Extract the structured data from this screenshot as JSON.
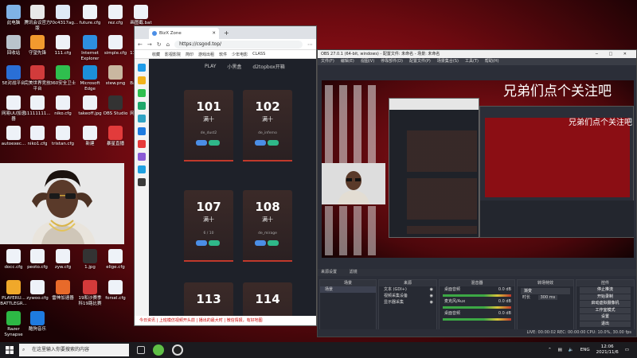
{
  "desktop_icons": [
    {
      "label": "此电脑",
      "color": "#7fb3e6"
    },
    {
      "label": "腾讯会议官方版",
      "color": "#e8e8e8"
    },
    {
      "label": "70c4317ag...",
      "color": "#dfe9f6"
    },
    {
      "label": "future.cfg",
      "color": "#eef2f8"
    },
    {
      "label": "rez.cfg",
      "color": "#eef2f8"
    },
    {
      "label": "画图截.bat",
      "color": "#eef2f8"
    },
    {
      "label": "回收站",
      "color": "#b9c4cc"
    },
    {
      "label": "守望先锋",
      "color": "#f29a2e"
    },
    {
      "label": "111.cfg",
      "color": "#eef2f8"
    },
    {
      "label": "Internet Explorer",
      "color": "#2d8fe0"
    },
    {
      "label": "simple.cfg",
      "color": "#eef2f8"
    },
    {
      "label": "1111...cfg",
      "color": "#eef2f8"
    },
    {
      "label": "5E对战平台",
      "color": "#2a6fd6"
    },
    {
      "label": "完美世界竞技平台",
      "color": "#d23b3b"
    },
    {
      "label": "360安全卫士",
      "color": "#2fbf4e"
    },
    {
      "label": "Microsoft Edge",
      "color": "#1c8fd8"
    },
    {
      "label": "stew.png",
      "color": "#c9b7a0"
    },
    {
      "label": "Bandicam",
      "color": "#d83a3a"
    },
    {
      "label": "网易UU加速器",
      "color": "#eef2f8"
    },
    {
      "label": "11111111...",
      "color": "#eef2f8"
    },
    {
      "label": "niko.cfg",
      "color": "#eef2f8"
    },
    {
      "label": "takeoff.jpg",
      "color": "#eef2f8"
    },
    {
      "label": "OBS Studio",
      "color": "#333333"
    },
    {
      "label": "网易云音乐",
      "color": "#d0343b"
    },
    {
      "label": "autoexec...",
      "color": "#eef2f8"
    },
    {
      "label": "niko1.cfg",
      "color": "#eef2f8"
    },
    {
      "label": "tristan.cfg",
      "color": "#eef2f8"
    },
    {
      "label": "新建",
      "color": "#eef2f8"
    },
    {
      "label": "暴星直播",
      "color": "#e23b3b"
    },
    {
      "label": "腾讯云",
      "color": "#eef2f8"
    },
    {
      "label": "docc.cfg",
      "color": "#eef2f8"
    },
    {
      "label": "peoto.cfg",
      "color": "#eef2f8"
    },
    {
      "label": "zyw.cfg",
      "color": "#eef2f8"
    },
    {
      "label": "1.jpg",
      "color": "#333333"
    },
    {
      "label": "elige.cfg",
      "color": "#eef2f8"
    },
    {
      "label": "PLAYERU... BATTLEGR...",
      "color": "#f0a82a"
    },
    {
      "label": "zywoo.cfg",
      "color": "#eef2f8"
    },
    {
      "label": "雷神加速器",
      "color": "#e86a2a"
    },
    {
      "label": "19和沙赛季 科19路比赛",
      "color": "#d33a3a"
    },
    {
      "label": "forsel.cfg",
      "color": "#eef2f8"
    },
    {
      "label": "Razer Synapse",
      "color": "#2db845"
    },
    {
      "label": "酷狗音乐",
      "color": "#1e7be0"
    }
  ],
  "browser": {
    "tab_title": "BizX Zone",
    "url": "https://csgod.top/",
    "bookmarks": [
      "收藏",
      "影视影院",
      "简印",
      "游戏出租",
      "软件",
      "少年电影",
      "CLASS"
    ],
    "nav": [
      "PLAY",
      "小黑盒",
      "d2topbox开箱"
    ],
    "cards": [
      {
        "number": "101",
        "status": "满十",
        "sub": "de_dust2"
      },
      {
        "number": "102",
        "status": "满十",
        "sub": "de_inferno"
      },
      {
        "number": "107",
        "status": "满十",
        "sub": "6 / 10"
      },
      {
        "number": "108",
        "status": "满十",
        "sub": "de_mirage"
      },
      {
        "number": "113",
        "status": "",
        "sub": ""
      },
      {
        "number": "114",
        "status": "",
        "sub": ""
      }
    ],
    "status_text": "今日资讯 | 上班模仿视频开头前 | 播出的最大时 | 微信情报，有好地图"
  },
  "obs": {
    "title": "OBS 27.0.1 (64-bit, windows) - 配置文件: 未命名 - 场景: 未命名",
    "menu": [
      "文件(F)",
      "编辑(E)",
      "视图(V)",
      "停靠部件(D)",
      "配置文件(P)",
      "场景集合(S)",
      "工具(T)",
      "帮助(H)"
    ],
    "overlay_text": "兄弟们点个关注吧",
    "bar_items": [
      "来源设置",
      "滤镜"
    ],
    "scenes_header": "场景",
    "scenes": [
      "场景"
    ],
    "sources_header": "来源",
    "sources": [
      "文本 (GDI+)",
      "视频采集设备",
      "显示器采集"
    ],
    "mixer_header": "混音器",
    "mixer": [
      {
        "name": "桌面音频",
        "level": "0.0 dB"
      },
      {
        "name": "麦克风/Aux",
        "level": "0.0 dB"
      },
      {
        "name": "桌面音频",
        "level": "0.0 dB"
      }
    ],
    "transitions_header": "转场特效",
    "transition": "渐变",
    "duration_label": "时长",
    "duration": "300 ms",
    "controls_header": "控件",
    "controls": [
      "停止推流",
      "开始录制",
      "启动虚拟摄像机",
      "工作室模式",
      "设置",
      "退出"
    ],
    "status": "LIVE: 00:00:02  REC: 00:00:00  CPU: 10.0%, 30.00 fps"
  },
  "taskbar": {
    "search_placeholder": "在这里输入你要搜索的内容",
    "lang": "ENG",
    "time": "12:06",
    "date": "2021/11/6"
  }
}
